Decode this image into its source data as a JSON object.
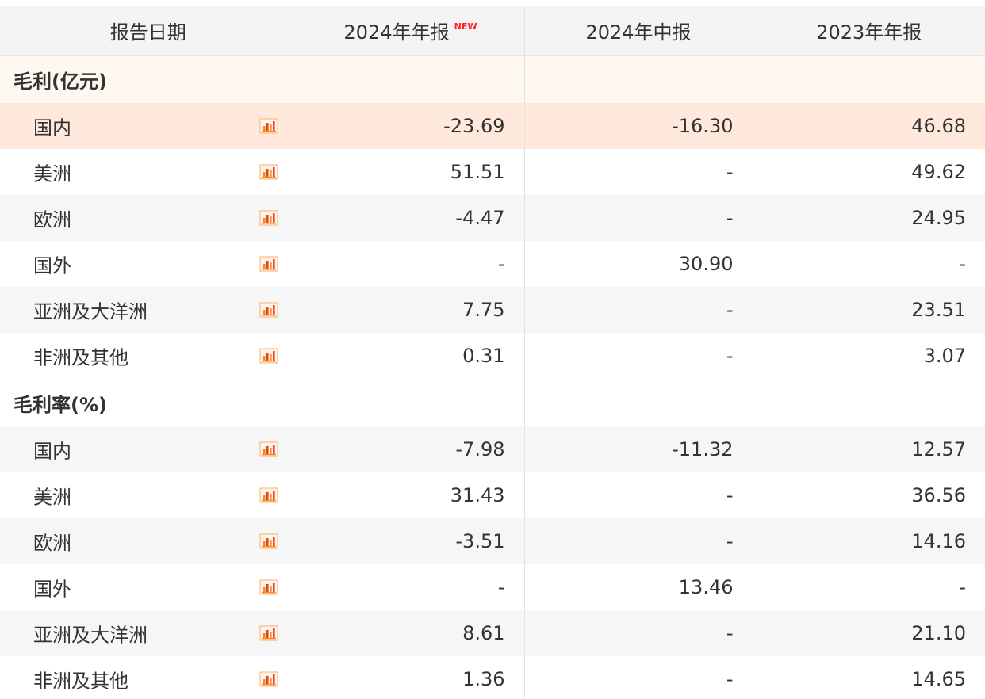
{
  "header": {
    "label_col": "报告日期",
    "periods": [
      "2024年年报",
      "2024年中报",
      "2023年年报"
    ],
    "new_badge": "NEW"
  },
  "sections": [
    {
      "title": "毛利(亿元)",
      "rows": [
        {
          "name": "国内",
          "values": [
            "-23.69",
            "-16.30",
            "46.68"
          ]
        },
        {
          "name": "美洲",
          "values": [
            "51.51",
            "-",
            "49.62"
          ]
        },
        {
          "name": "欧洲",
          "values": [
            "-4.47",
            "-",
            "24.95"
          ]
        },
        {
          "name": "国外",
          "values": [
            "-",
            "30.90",
            "-"
          ]
        },
        {
          "name": "亚洲及大洋洲",
          "values": [
            "7.75",
            "-",
            "23.51"
          ]
        },
        {
          "name": "非洲及其他",
          "values": [
            "0.31",
            "-",
            "3.07"
          ]
        }
      ]
    },
    {
      "title": "毛利率(%)",
      "rows": [
        {
          "name": "国内",
          "values": [
            "-7.98",
            "-11.32",
            "12.57"
          ]
        },
        {
          "name": "美洲",
          "values": [
            "31.43",
            "-",
            "36.56"
          ]
        },
        {
          "name": "欧洲",
          "values": [
            "-3.51",
            "-",
            "14.16"
          ]
        },
        {
          "name": "国外",
          "values": [
            "-",
            "13.46",
            "-"
          ]
        },
        {
          "name": "亚洲及大洋洲",
          "values": [
            "8.61",
            "-",
            "21.10"
          ]
        },
        {
          "name": "非洲及其他",
          "values": [
            "1.36",
            "-",
            "14.65"
          ]
        }
      ]
    }
  ],
  "icons": {
    "row_chart": "bar-chart-icon"
  },
  "colors": {
    "chart_icon_orange": "#f58a1f",
    "chart_icon_red": "#e4432f",
    "new_badge": "#ff1f1f",
    "highlight_row": "#ffe9dc",
    "section_tint": "#fff8f1"
  }
}
